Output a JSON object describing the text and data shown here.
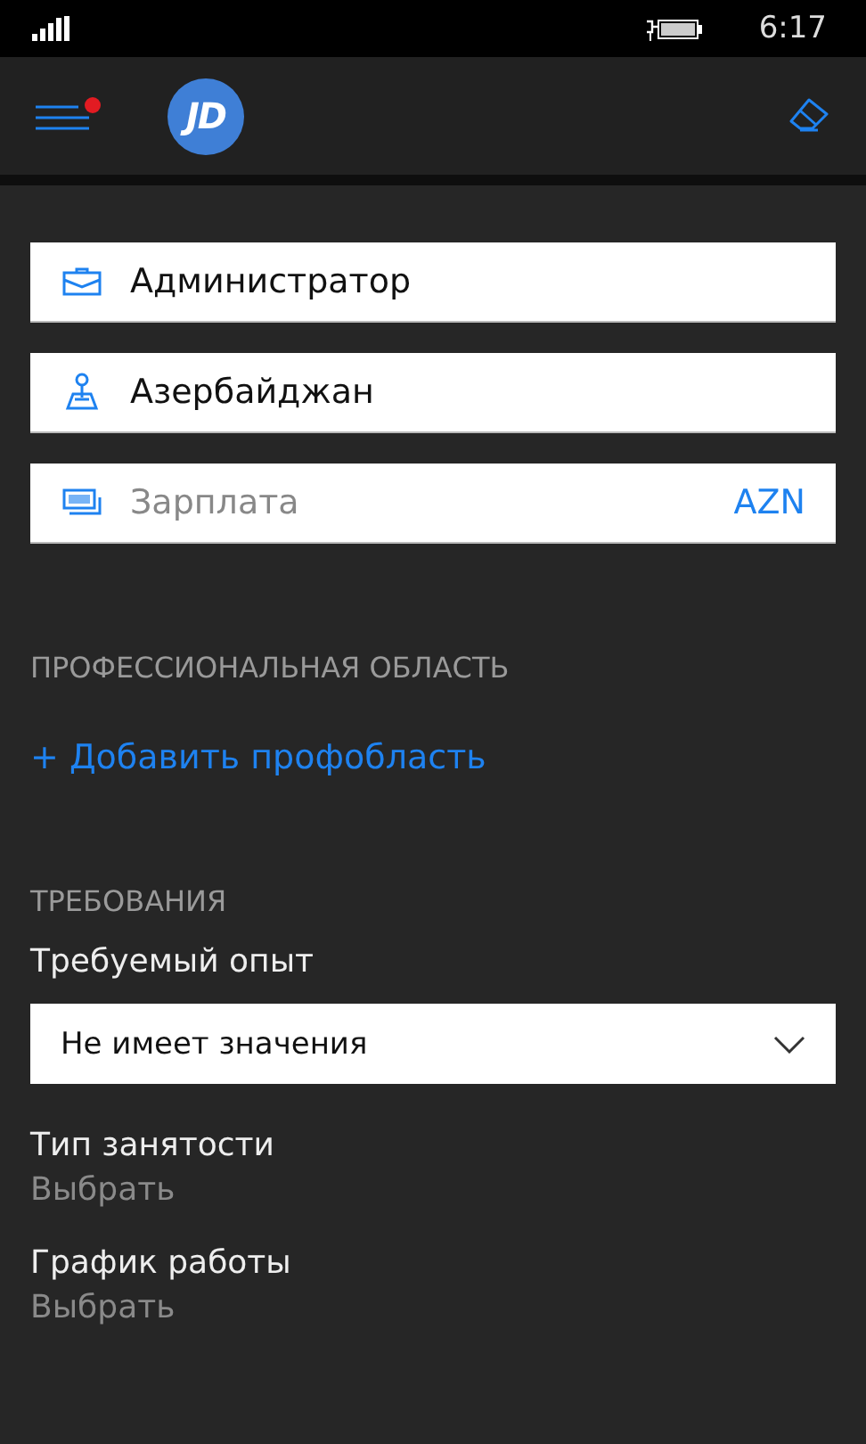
{
  "status_bar": {
    "time": "6:17"
  },
  "app_bar": {
    "menu_notification": true,
    "logo": "JD"
  },
  "fields": [
    {
      "kind": "value",
      "value": "Администратор"
    },
    {
      "kind": "value",
      "value": "Азербайджан"
    },
    {
      "kind": "placeholder",
      "placeholder": "Зарплата",
      "suffix": "AZN"
    }
  ],
  "professional_area": {
    "heading": "ПРОФЕССИОНАЛЬНАЯ ОБЛАСТЬ",
    "add_link": "+ Добавить профобласть"
  },
  "requirements": {
    "heading": "ТРЕБОВАНИЯ",
    "experience_label": "Требуемый опыт",
    "experience_value": "Не имеет значения",
    "pickers": [
      {
        "label": "Тип занятости",
        "placeholder": "Выбрать"
      },
      {
        "label": "График работы",
        "placeholder": "Выбрать"
      }
    ]
  }
}
